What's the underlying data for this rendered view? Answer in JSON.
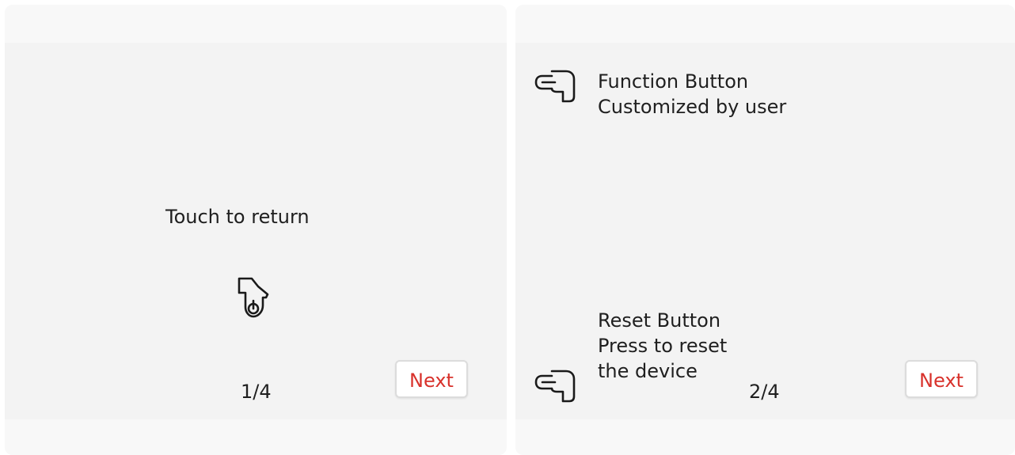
{
  "screens": [
    {
      "message": "Touch to return",
      "page_indicator": "1/4",
      "next_label": "Next",
      "icon": "tap-finger-icon"
    },
    {
      "function_button": {
        "title": "Function Button",
        "description": "Customized by user",
        "icon": "pointing-hand-icon"
      },
      "reset_button": {
        "title": "Reset Button",
        "description_line1": "Press to reset",
        "description_line2": "the device",
        "icon": "pointing-hand-icon"
      },
      "page_indicator": "2/4",
      "next_label": "Next"
    }
  ],
  "colors": {
    "accent": "#d8322c",
    "panel_bg": "#f3f3f3",
    "text": "#1f1f1f"
  }
}
